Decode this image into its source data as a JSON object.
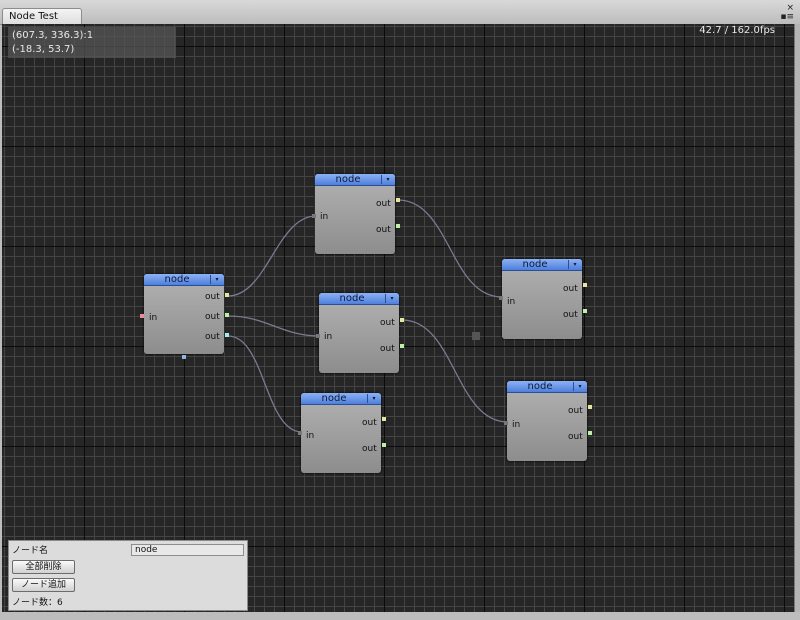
{
  "window": {
    "tab_title": "Node Test",
    "close_glyph": "×",
    "menu_glyph": "▪≡"
  },
  "canvas": {
    "mouse_coord": "(607.3, 336.3):1",
    "offset_coord": "(-18.3, 53.7)",
    "fps": "42.7 / 162.0fps"
  },
  "nodes": [
    {
      "title": "node",
      "menu_glyph": "▾",
      "input_label": "in",
      "output_labels": [
        "out",
        "out"
      ]
    },
    {
      "title": "node",
      "menu_glyph": "▾",
      "input_label": "in",
      "output_labels": [
        "out",
        "out",
        "out"
      ]
    },
    {
      "title": "node",
      "menu_glyph": "▾",
      "input_label": "in",
      "output_labels": [
        "out",
        "out"
      ]
    },
    {
      "title": "node",
      "menu_glyph": "▾",
      "input_label": "in",
      "output_labels": [
        "out",
        "out"
      ]
    },
    {
      "title": "node",
      "menu_glyph": "▾",
      "input_label": "in",
      "output_labels": [
        "out",
        "out"
      ]
    },
    {
      "title": "node",
      "menu_glyph": "▾",
      "input_label": "in",
      "output_labels": [
        "out",
        "out"
      ]
    }
  ],
  "panel": {
    "node_name_label": "ノード名",
    "node_name_value": "node",
    "delete_all_label": "全部削除",
    "add_node_label": "ノード追加",
    "node_count_text": "ノード数：6"
  },
  "colors": {
    "header_blue": "#5b8ae0",
    "output_port_yellow": "#e6e6a0",
    "output_port_green": "#bff0a8",
    "output_port_cyan": "#a8e8f0",
    "input_port_pink": "#e88a9a",
    "wire": "#7a7a90"
  },
  "icons": {
    "node_menu": "dropdown-arrow-icon",
    "window_close": "close-icon",
    "window_menu": "menu-icon"
  }
}
